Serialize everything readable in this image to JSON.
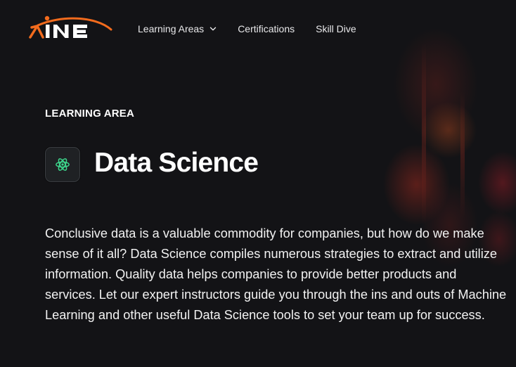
{
  "brand": {
    "logo_text": "INE",
    "accent": "#F26B1D"
  },
  "nav": {
    "items": [
      {
        "label": "Learning Areas",
        "has_dropdown": true,
        "icon": "chevron-down-icon"
      },
      {
        "label": "Certifications"
      },
      {
        "label": "Skill Dive"
      }
    ]
  },
  "hero": {
    "eyebrow": "LEARNING AREA",
    "icon": "atom-icon",
    "icon_color": "#3DD68C",
    "title": "Data Science",
    "description": "Conclusive data is a valuable commodity for companies, but how do we make sense of it all? Data Science compiles numerous strategies to extract and utilize information. Quality data helps companies to provide better products and services. Let our expert instructors guide you through the ins and outs of Machine Learning and other useful Data Science tools to set your team up for success."
  }
}
